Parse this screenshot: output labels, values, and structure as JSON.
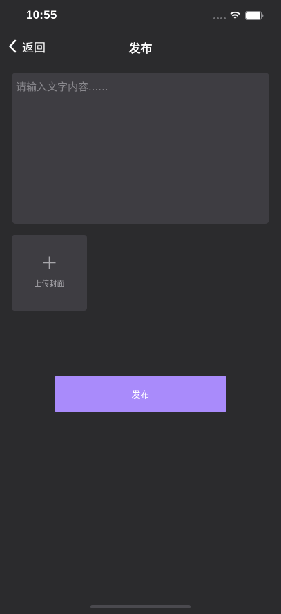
{
  "status_bar": {
    "time": "10:55",
    "wifi_icon": "wifi-icon",
    "battery_icon": "battery-icon"
  },
  "nav": {
    "back_icon": "chevron-left-icon",
    "back_label": "返回",
    "title": "发布"
  },
  "content_input": {
    "placeholder": "请输入文字内容......",
    "value": ""
  },
  "upload": {
    "icon": "plus-icon",
    "label": "上传封面"
  },
  "publish_button": {
    "label": "发布"
  },
  "colors": {
    "background": "#2b2b2d",
    "input_background": "#3e3d42",
    "accent": "#a98bfb",
    "placeholder": "#8a898e"
  }
}
